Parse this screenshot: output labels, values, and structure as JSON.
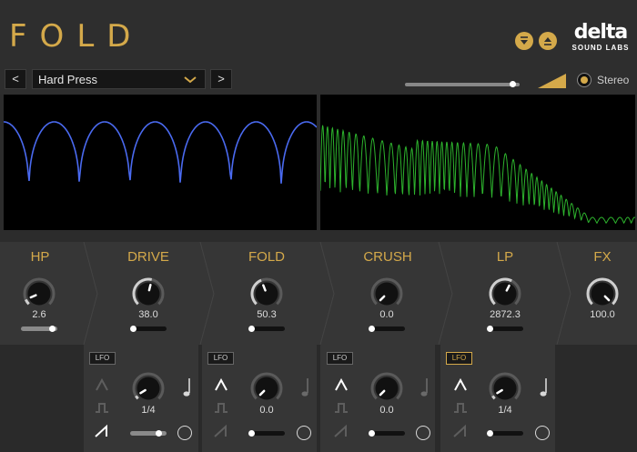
{
  "header": {
    "title": "FOLD"
  },
  "logo": {
    "main": "delta",
    "sub": "SOUND LABS"
  },
  "preset": {
    "prev_label": "<",
    "next_label": ">",
    "name": "Hard Press"
  },
  "output": {
    "mix_level": 0.97,
    "stereo_label": "Stereo",
    "stereo_enabled": true
  },
  "colors": {
    "accent": "#d4a94a",
    "waveform": "#4a6af0",
    "spectrum": "#2db32d",
    "panel": "#363636",
    "background": "#2c2c2c"
  },
  "sections": [
    {
      "title": "HP",
      "value": "2.6",
      "knob_level": 0.08,
      "slider_level": 0.95
    },
    {
      "title": "DRIVE",
      "value": "38.0",
      "knob_level": 0.55,
      "slider_level": 0.0
    },
    {
      "title": "FOLD",
      "value": "50.3",
      "knob_level": 0.42,
      "slider_level": 0.0
    },
    {
      "title": "CRUSH",
      "value": "0.0",
      "knob_level": 0.0,
      "slider_level": 0.0
    },
    {
      "title": "LP",
      "value": "2872.3",
      "knob_level": 0.6,
      "slider_level": 0.0
    },
    {
      "title": "FX",
      "value": "100.0",
      "knob_level": 1.0,
      "slider_level": null
    }
  ],
  "lfos": [
    {
      "label": "LFO",
      "active": false,
      "shape": "saw",
      "rate_value": "1/4",
      "rate_knob_level": 0.05,
      "amount_level": 0.85,
      "note_icon": "quarter-note-icon"
    },
    {
      "label": "LFO",
      "active": false,
      "shape": "triangle",
      "rate_value": "0.0",
      "rate_knob_level": 0.0,
      "amount_level": 0.0,
      "note_icon": "quarter-note-icon"
    },
    {
      "label": "LFO",
      "active": false,
      "shape": "triangle",
      "rate_value": "0.0",
      "rate_knob_level": 0.0,
      "amount_level": 0.0,
      "note_icon": "quarter-note-icon"
    },
    {
      "label": "LFO",
      "active": true,
      "shape": "triangle",
      "rate_value": "1/4",
      "rate_knob_level": 0.05,
      "amount_level": 0.0,
      "note_icon": "quarter-note-icon"
    }
  ]
}
